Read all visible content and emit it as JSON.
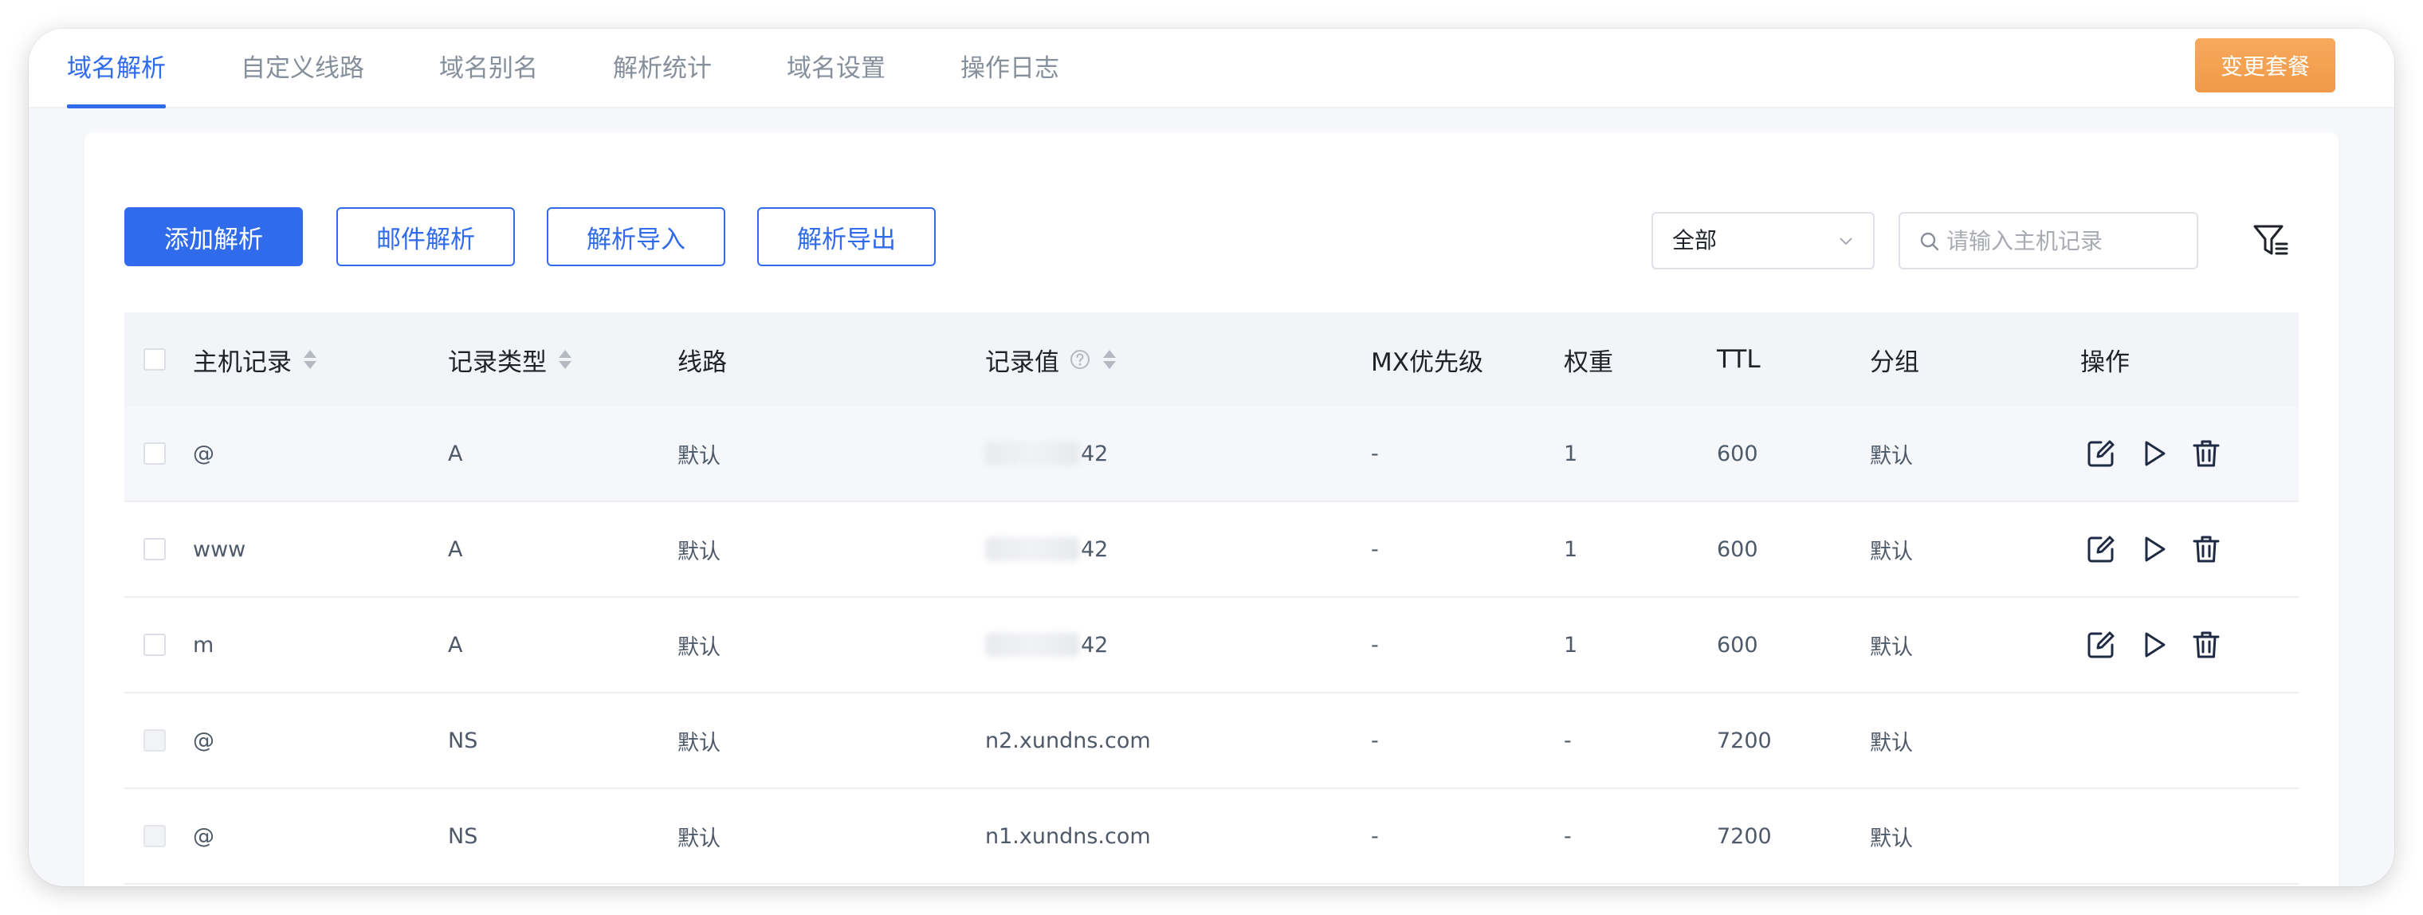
{
  "tabs": [
    {
      "label": "域名解析",
      "active": true
    },
    {
      "label": "自定义线路",
      "active": false
    },
    {
      "label": "域名别名",
      "active": false
    },
    {
      "label": "解析统计",
      "active": false
    },
    {
      "label": "域名设置",
      "active": false
    },
    {
      "label": "操作日志",
      "active": false
    }
  ],
  "header": {
    "upgrade_label": "变更套餐"
  },
  "toolbar": {
    "add_label": "添加解析",
    "mail_label": "邮件解析",
    "import_label": "解析导入",
    "export_label": "解析导出",
    "select_value": "全部",
    "search_placeholder": "请输入主机记录"
  },
  "table": {
    "columns": {
      "host": "主机记录",
      "type": "记录类型",
      "line": "线路",
      "value": "记录值",
      "mx": "MX优先级",
      "weight": "权重",
      "ttl": "TTL",
      "group": "分组",
      "ops": "操作"
    },
    "rows": [
      {
        "host": "@",
        "type": "A",
        "line": "默认",
        "value": "42",
        "value_masked": true,
        "mx": "-",
        "weight": "1",
        "ttl": "600",
        "group": "默认",
        "actions": true
      },
      {
        "host": "www",
        "type": "A",
        "line": "默认",
        "value": "42",
        "value_masked": true,
        "mx": "-",
        "weight": "1",
        "ttl": "600",
        "group": "默认",
        "actions": true
      },
      {
        "host": "m",
        "type": "A",
        "line": "默认",
        "value": "42",
        "value_masked": true,
        "mx": "-",
        "weight": "1",
        "ttl": "600",
        "group": "默认",
        "actions": true
      },
      {
        "host": "@",
        "type": "NS",
        "line": "默认",
        "value": "n2.xundns.com",
        "value_masked": false,
        "mx": "-",
        "weight": "-",
        "ttl": "7200",
        "group": "默认",
        "actions": false
      },
      {
        "host": "@",
        "type": "NS",
        "line": "默认",
        "value": "n1.xundns.com",
        "value_masked": false,
        "mx": "-",
        "weight": "-",
        "ttl": "7200",
        "group": "默认",
        "actions": false
      }
    ]
  },
  "icons": {
    "sort": "sort-icon",
    "help": "help-circle-icon",
    "edit": "edit-icon",
    "enable": "play-icon",
    "delete": "trash-icon",
    "filter": "filter-icon",
    "search": "search-icon",
    "chevron": "chevron-down-icon"
  },
  "colors": {
    "primary": "#2f6bea",
    "accent": "#f09a48"
  }
}
